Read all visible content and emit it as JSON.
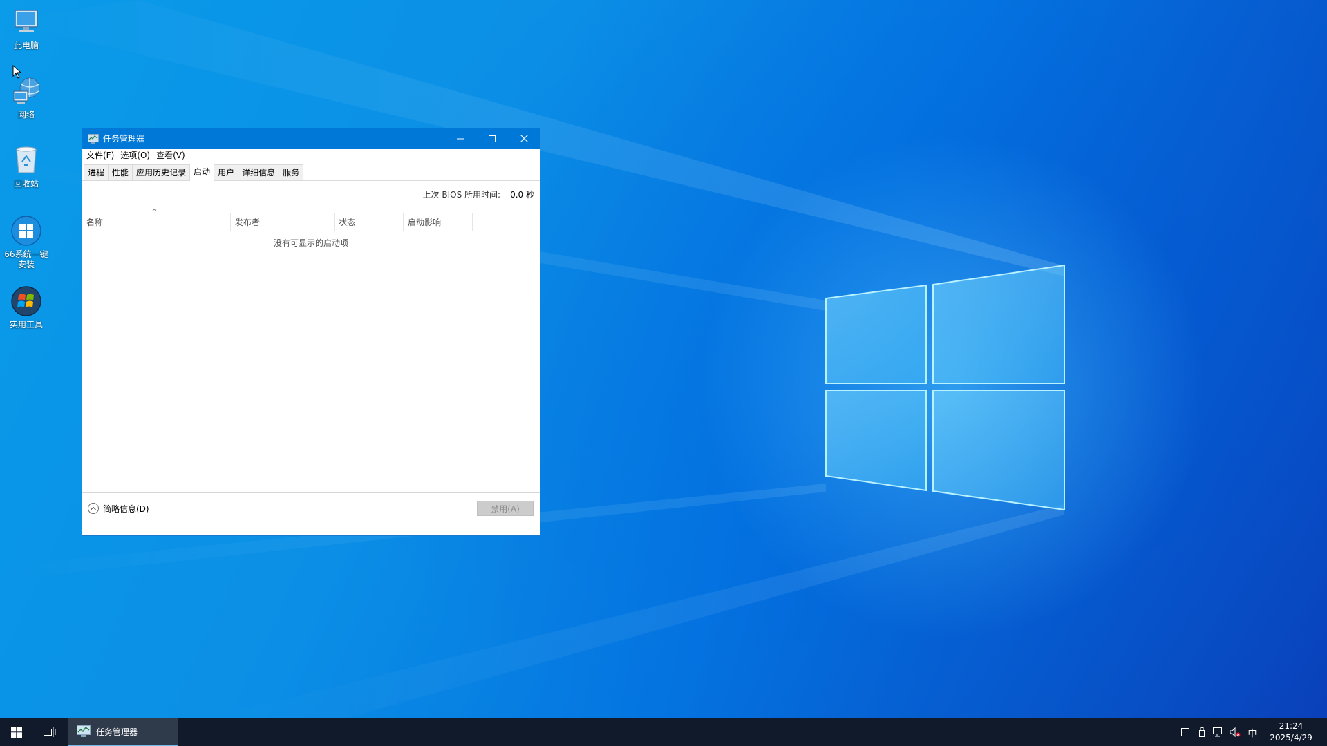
{
  "desktop": {
    "icons": [
      {
        "label": "此电脑",
        "icon": "computer-icon"
      },
      {
        "label": "网络",
        "icon": "network-icon"
      },
      {
        "label": "回收站",
        "icon": "recycle-bin-icon"
      },
      {
        "label": "66系统一键\n安装",
        "icon": "windows-installer-icon"
      },
      {
        "label": "实用工具",
        "icon": "utility-tools-icon"
      }
    ]
  },
  "task_manager": {
    "title": "任务管理器",
    "menu": [
      "文件(F)",
      "选项(O)",
      "查看(V)"
    ],
    "tabs": [
      "进程",
      "性能",
      "应用历史记录",
      "启动",
      "用户",
      "详细信息",
      "服务"
    ],
    "active_tab": "启动",
    "bios_label": "上次 BIOS 所用时间:",
    "bios_value": "0.0 秒",
    "columns": [
      "名称",
      "发布者",
      "状态",
      "启动影响"
    ],
    "empty_message": "没有可显示的启动项",
    "fewer_details": "简略信息(D)",
    "disable_button": "禁用(A)"
  },
  "taskbar": {
    "task_label": "任务管理器",
    "ime": "中",
    "time": "21:24",
    "date": "2025/4/29"
  },
  "colors": {
    "titlebar": "#0078d7",
    "taskbar": "#101a2a",
    "accent": "#76b9ed"
  }
}
